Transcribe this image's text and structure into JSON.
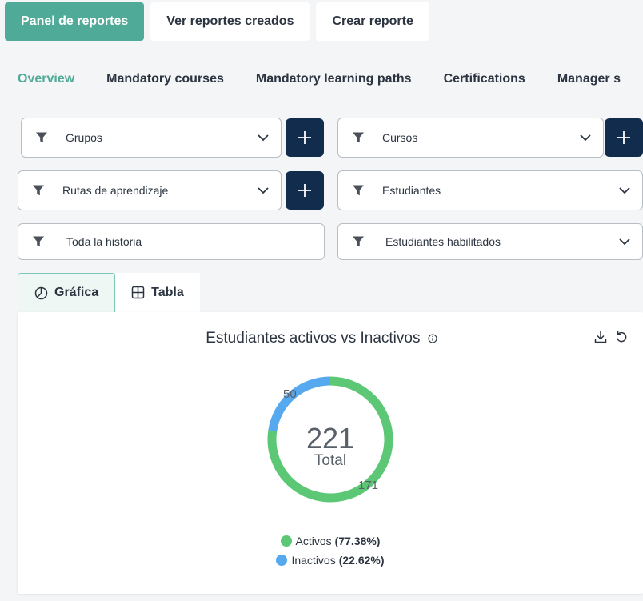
{
  "top_tabs": [
    "Panel de reportes",
    "Ver reportes creados",
    "Crear reporte"
  ],
  "sub_tabs": [
    "Overview",
    "Mandatory courses",
    "Mandatory learning paths",
    "Certifications",
    "Manager s"
  ],
  "filters": {
    "grupos": "Grupos",
    "cursos": "Cursos",
    "rutas": "Rutas de aprendizaje",
    "estudiantes": "Estudiantes",
    "historia": "Toda la historia",
    "habilitados": "Estudiantes habilitados"
  },
  "view_tabs": {
    "grafica": "Gráfica",
    "tabla": "Tabla"
  },
  "card": {
    "title": "Estudiantes activos vs Inactivos",
    "total_label": "Total"
  },
  "chart_data": {
    "type": "pie",
    "title": "Estudiantes activos vs Inactivos",
    "total": 221,
    "categories": [
      "Activos",
      "Inactivos"
    ],
    "values": [
      171,
      50
    ],
    "percent_labels": [
      "(77.38%)",
      "(22.62%)"
    ],
    "colors": [
      "#5cc775",
      "#56a9ef"
    ],
    "legend_position": "bottom"
  },
  "colors": {
    "accent": "#4faa98",
    "navy": "#112c4c"
  },
  "icons": [
    "funnel-icon",
    "chevron-down-icon",
    "plus-icon",
    "pie-chart-icon",
    "table-icon",
    "info-icon",
    "download-icon",
    "refresh-icon"
  ]
}
